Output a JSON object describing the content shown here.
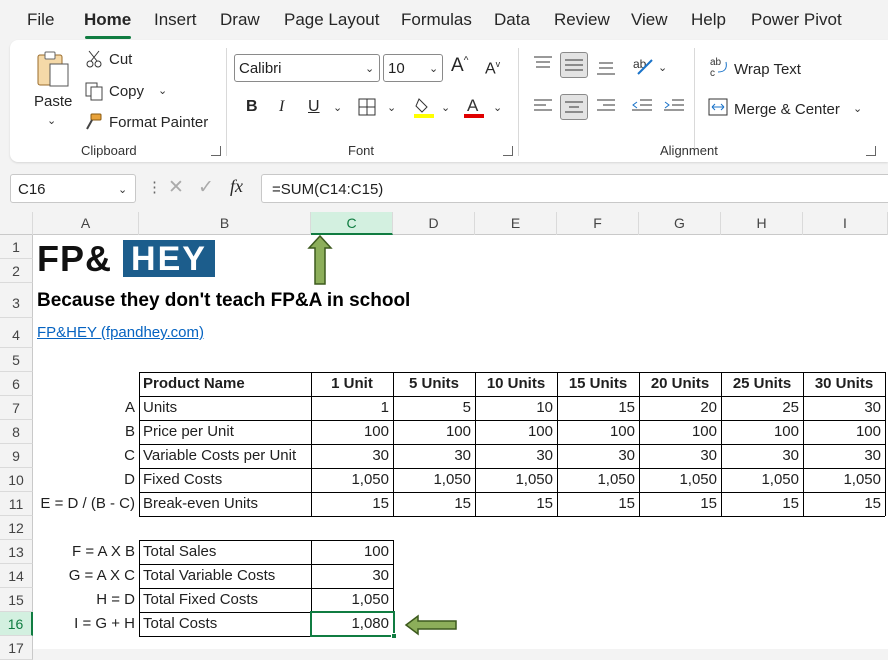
{
  "menu": [
    "File",
    "Home",
    "Insert",
    "Draw",
    "Page Layout",
    "Formulas",
    "Data",
    "Review",
    "View",
    "Help",
    "Power Pivot"
  ],
  "clipboard": {
    "paste": "Paste",
    "cut": "Cut",
    "copy": "Copy",
    "format_painter": "Format Painter",
    "group": "Clipboard"
  },
  "font": {
    "name": "Calibri",
    "size": "10",
    "group": "Font"
  },
  "alignment": {
    "wrap": "Wrap Text",
    "merge": "Merge & Center",
    "group": "Alignment"
  },
  "formula_bar": {
    "cell_ref": "C16",
    "formula": "=SUM(C14:C15)",
    "fx": "fx"
  },
  "columns": [
    "A",
    "B",
    "C",
    "D",
    "E",
    "F",
    "G",
    "H",
    "I"
  ],
  "rows": [
    "1",
    "2",
    "3",
    "4",
    "5",
    "6",
    "7",
    "8",
    "9",
    "10",
    "11",
    "12",
    "13",
    "14",
    "15",
    "16",
    "17"
  ],
  "sheet": {
    "logo_left": "FP&",
    "logo_right": "HEY",
    "subtitle": "Because they don't teach FP&A in school",
    "link": "FP&HEY (fpandhey.com)"
  },
  "table1": {
    "header": [
      "Product Name",
      "1 Unit",
      "5 Units",
      "10 Units",
      "15 Units",
      "20 Units",
      "25 Units",
      "30 Units"
    ],
    "rows": [
      {
        "key": "A",
        "label": "Units",
        "values": [
          "1",
          "5",
          "10",
          "15",
          "20",
          "25",
          "30"
        ]
      },
      {
        "key": "B",
        "label": "Price per Unit",
        "values": [
          "100",
          "100",
          "100",
          "100",
          "100",
          "100",
          "100"
        ]
      },
      {
        "key": "C",
        "label": "Variable Costs per Unit",
        "values": [
          "30",
          "30",
          "30",
          "30",
          "30",
          "30",
          "30"
        ]
      },
      {
        "key": "D",
        "label": "Fixed Costs",
        "values": [
          "1,050",
          "1,050",
          "1,050",
          "1,050",
          "1,050",
          "1,050",
          "1,050"
        ]
      },
      {
        "key": "E = D / (B - C)",
        "label": "Break-even Units",
        "values": [
          "15",
          "15",
          "15",
          "15",
          "15",
          "15",
          "15"
        ]
      }
    ]
  },
  "table2": {
    "rows": [
      {
        "key": "F = A X B",
        "label": "Total Sales",
        "value": "100"
      },
      {
        "key": "G = A X C",
        "label": "Total Variable Costs",
        "value": "30"
      },
      {
        "key": "H = D",
        "label": "Total Fixed Costs",
        "value": "1,050"
      },
      {
        "key": "I = G + H",
        "label": "Total Costs",
        "value": "1,080"
      }
    ]
  },
  "colors": {
    "accent": "#107c41",
    "logo_blue": "#1c5d8c",
    "arrow": "#8cae5a",
    "link": "#0563c1"
  }
}
